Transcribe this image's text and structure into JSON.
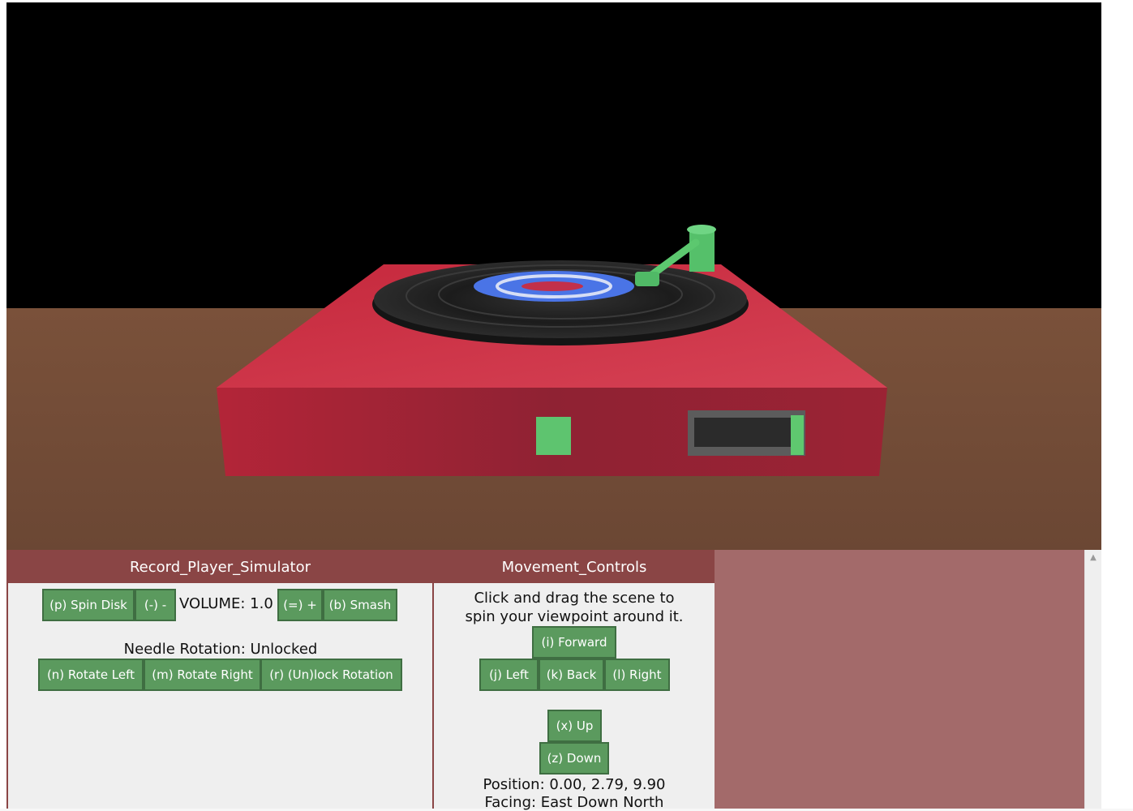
{
  "scene": {
    "colors": {
      "sky": "#000000",
      "floor": "#6e4a35",
      "player_body": "#c22a3d",
      "record": "#1e1e1e",
      "label_blue": "#4a74e6",
      "accent_green": "#59c46a"
    }
  },
  "record_panel": {
    "title": "Record_Player_Simulator",
    "spin_button": "(p) Spin Disk",
    "volume_down_button": "(-) -",
    "volume_label": "VOLUME: 1.0",
    "volume_up_button": "(=) +",
    "smash_button": "(b) Smash",
    "needle_status": "Needle Rotation: Unlocked",
    "rotate_left_button": "(n) Rotate Left",
    "rotate_right_button": "(m) Rotate Right",
    "lock_button": "(r) (Un)lock Rotation"
  },
  "movement_panel": {
    "title": "Movement_Controls",
    "instructions_line1": "Click and drag the scene to",
    "instructions_line2": "spin your viewpoint around it.",
    "forward_button": "(i) Forward",
    "left_button": "(j) Left",
    "back_button": "(k) Back",
    "right_button": "(l) Right",
    "up_button": "(x) Up",
    "down_button": "(z) Down",
    "position": "Position: 0.00, 2.79, 9.90",
    "facing": "Facing: East Down North"
  },
  "colors": {
    "panel_header": "#8a4545",
    "panel_bg": "#efefef",
    "button_bg": "#5b9a5e",
    "extra_panel": "#a36a6a"
  }
}
